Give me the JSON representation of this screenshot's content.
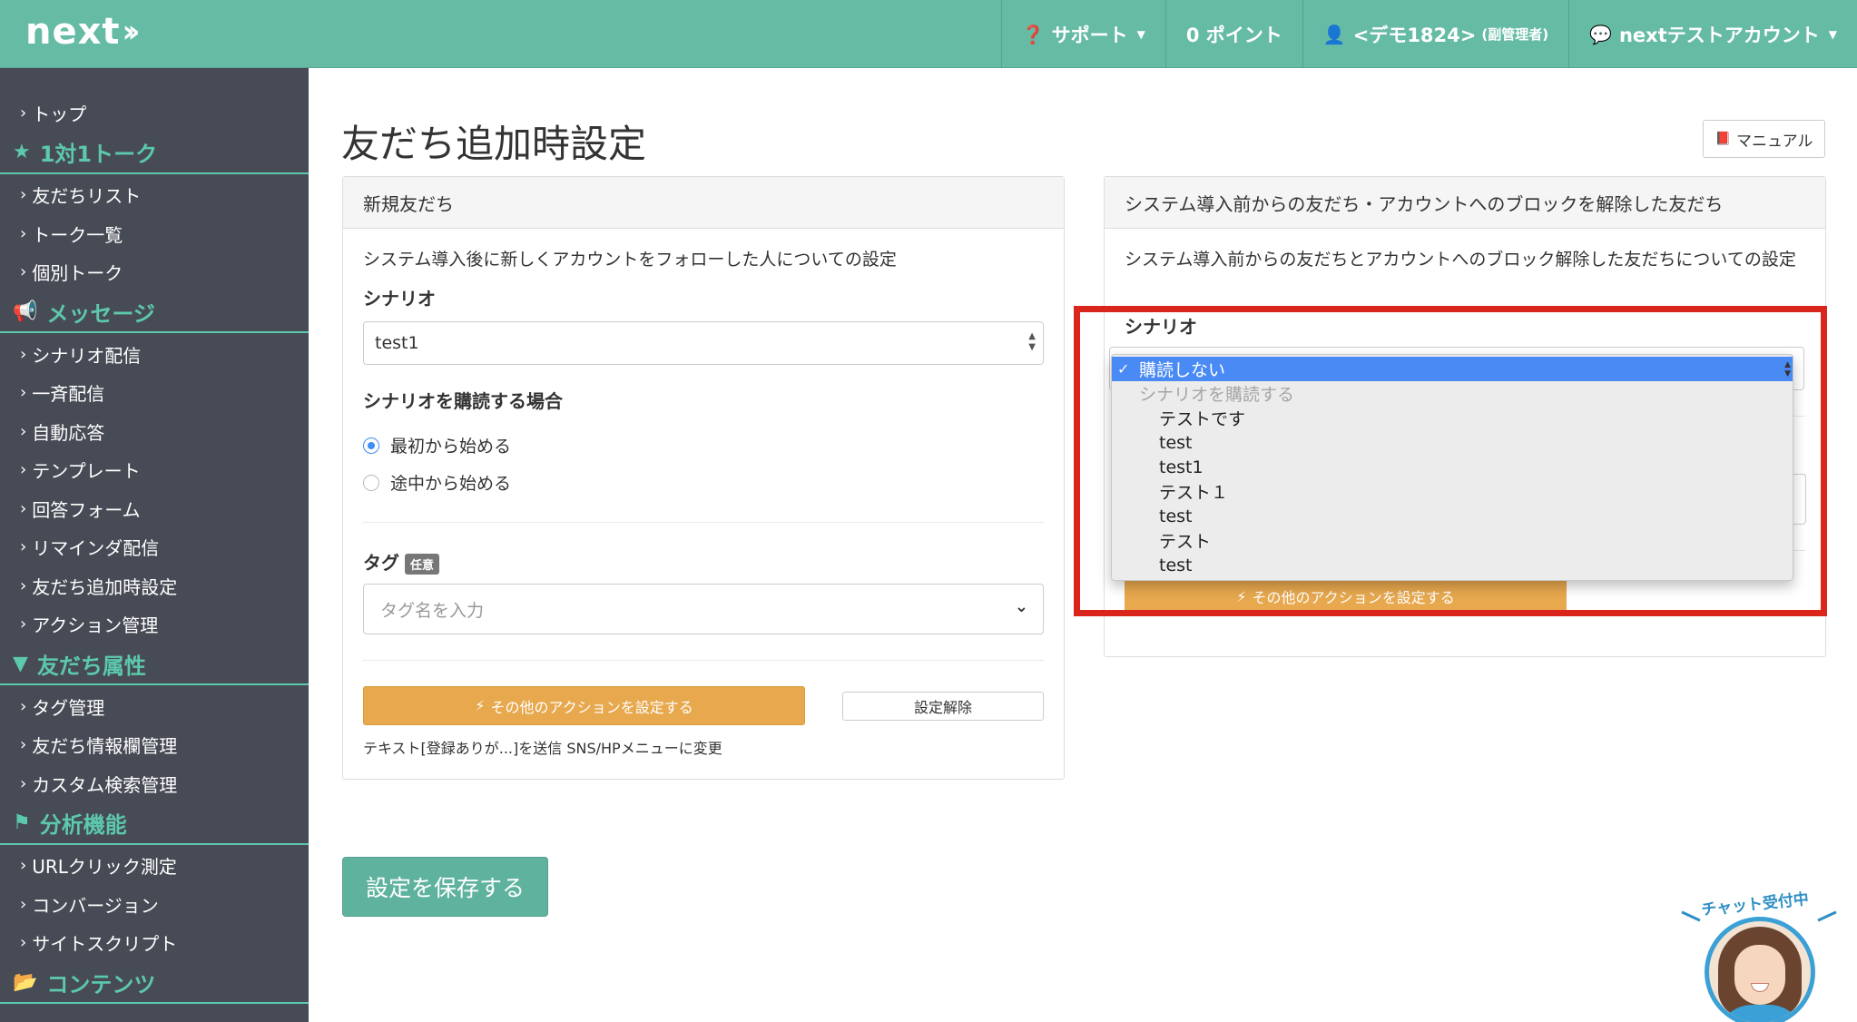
{
  "header": {
    "logo": "next",
    "nav": {
      "support": "サポート",
      "points": "0 ポイント",
      "user": "<デモ1824>",
      "user_role": "(副管理者)",
      "account": "nextテストアカウント"
    }
  },
  "sidebar": {
    "top": "トップ",
    "sections": [
      {
        "title": "1対1トーク",
        "items": [
          "友だちリスト",
          "トーク一覧",
          "個別トーク"
        ]
      },
      {
        "title": "メッセージ",
        "items": [
          "シナリオ配信",
          "一斉配信",
          "自動応答",
          "テンプレート",
          "回答フォーム",
          "リマインダ配信",
          "友だち追加時設定",
          "アクション管理"
        ]
      },
      {
        "title": "友だち属性",
        "items": [
          "タグ管理",
          "友だち情報欄管理",
          "カスタム検索管理"
        ]
      },
      {
        "title": "分析機能",
        "items": [
          "URLクリック測定",
          "コンバージョン",
          "サイトスクリプト"
        ]
      },
      {
        "title": "コンテンツ",
        "items": []
      }
    ]
  },
  "page": {
    "title": "友だち追加時設定",
    "manual_label": "マニュアル",
    "save_label": "設定を保存する"
  },
  "left_panel": {
    "title": "新規友だち",
    "description": "システム導入後に新しくアカウントをフォローした人についての設定",
    "scenario_label": "シナリオ",
    "scenario_value": "test1",
    "subscribe_label": "シナリオを購読する場合",
    "radio_options": [
      "最初から始める",
      "途中から始める"
    ],
    "tag_label": "タグ",
    "tag_badge": "任意",
    "tag_placeholder": "タグ名を入力",
    "action_label": "その他のアクションを設定する",
    "clear_label": "設定解除",
    "summary": "テキスト[登録ありが...]を送信 SNS/HPメニューに変更"
  },
  "right_panel": {
    "title": "システム導入前からの友だち・アカウントへのブロックを解除した友だち",
    "description": "システム導入前からの友だちとアカウントへのブロック解除した友だちについての設定",
    "scenario_label": "シナリオ",
    "action_label": "その他のアクションを設定する",
    "dropdown": {
      "selected": "購読しない",
      "group_label": "シナリオを購読する",
      "options": [
        "テストです",
        "test",
        "test1",
        "テスト１",
        "test",
        "テスト",
        "test"
      ]
    }
  },
  "chat_widget": {
    "label": "チャット受付中"
  },
  "colors": {
    "header_bg": "#66bba5",
    "sidebar_bg": "#474b55",
    "sidebar_accent": "#5cc8ac",
    "action_orange": "#e7a84e",
    "save_green": "#5fb39e",
    "highlight_red": "#d9251b",
    "dropdown_select": "#4a8af4"
  }
}
